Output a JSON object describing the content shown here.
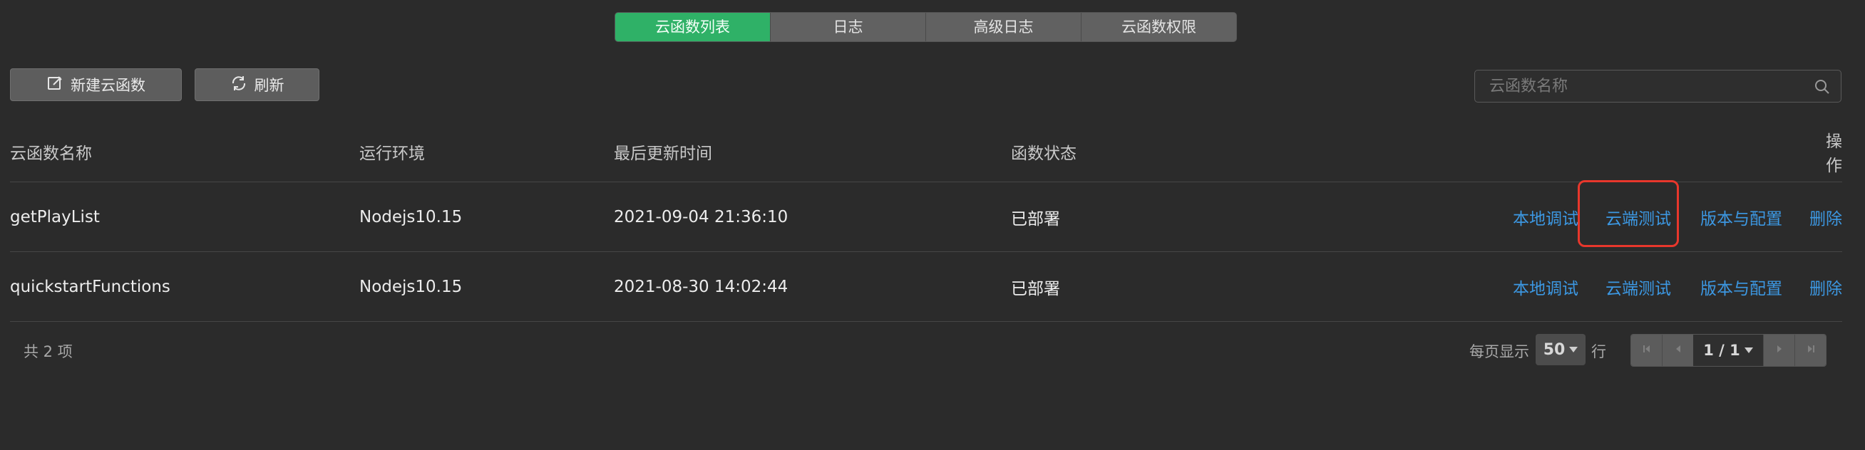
{
  "tabs": [
    {
      "label": "云函数列表",
      "active": true
    },
    {
      "label": "日志",
      "active": false
    },
    {
      "label": "高级日志",
      "active": false
    },
    {
      "label": "云函数权限",
      "active": false
    }
  ],
  "toolbar": {
    "new_label": "新建云函数",
    "refresh_label": "刷新",
    "search_placeholder": "云函数名称"
  },
  "table": {
    "headers": {
      "name": "云函数名称",
      "runtime": "运行环境",
      "updated": "最后更新时间",
      "status": "函数状态",
      "ops": "操作"
    },
    "rows": [
      {
        "name": "getPlayList",
        "runtime": "Nodejs10.15",
        "updated": "2021-09-04 21:36:10",
        "status": "已部署",
        "ops": [
          "本地调试",
          "云端测试",
          "版本与配置",
          "删除"
        ]
      },
      {
        "name": "quickstartFunctions",
        "runtime": "Nodejs10.15",
        "updated": "2021-08-30 14:02:44",
        "status": "已部署",
        "ops": [
          "本地调试",
          "云端测试",
          "版本与配置",
          "删除"
        ]
      }
    ]
  },
  "footer": {
    "total": "共 2 项",
    "per_page_label": "每页显示",
    "per_page_value": "50",
    "row_label": "行",
    "page": "1 / 1"
  },
  "colors": {
    "accent": "#2fb167",
    "link": "#3c98e3",
    "highlight": "#e8372c"
  }
}
